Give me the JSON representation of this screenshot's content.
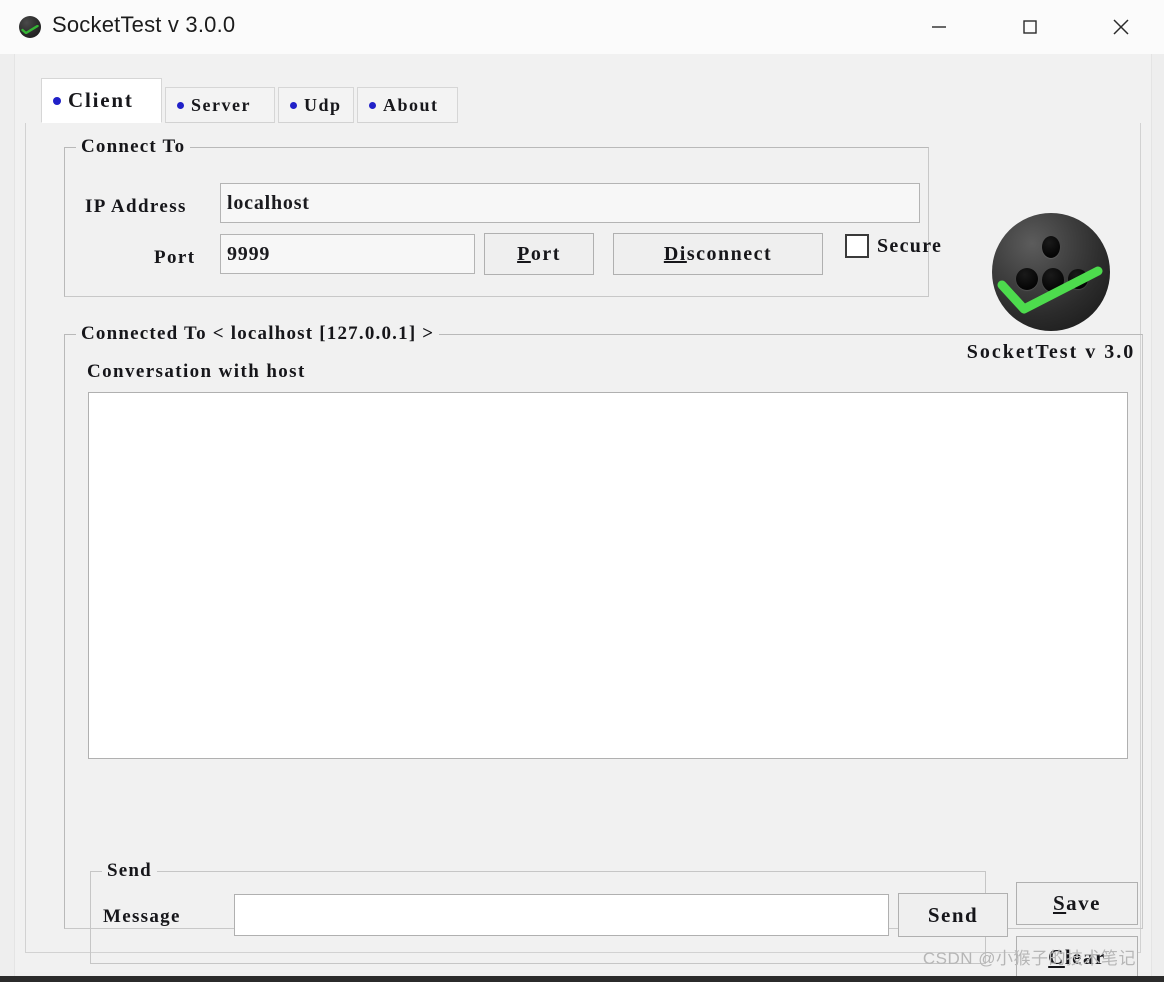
{
  "window": {
    "title": "SocketTest v 3.0.0",
    "icon": "socket-app-icon",
    "controls": {
      "minimize": "minimize-icon",
      "maximize": "maximize-icon",
      "close": "close-icon"
    }
  },
  "tabs": [
    {
      "label": "Client",
      "active": true
    },
    {
      "label": "Server",
      "active": false
    },
    {
      "label": "Udp",
      "active": false
    },
    {
      "label": "About",
      "active": false
    }
  ],
  "connect_to": {
    "group_title": "Connect To",
    "ip_label": "IP Address",
    "ip_value": "localhost",
    "ip_placeholder": "",
    "port_label": "Port",
    "port_value": "9999",
    "port_placeholder": "",
    "port_button": "Port",
    "port_button_accel": "P",
    "port_button_rest": "ort",
    "disconnect_button": "Disconnect",
    "disconnect_accel": "Di",
    "disconnect_rest": "sconnect",
    "secure_label": "Secure",
    "secure_checked": false
  },
  "logo": {
    "caption": "SocketTest v 3.0",
    "sphere": "socket-sphere-icon",
    "check": "green-check-icon",
    "check_color": "#4ddb4d"
  },
  "connected_to": {
    "group_title": "Connected To <  localhost [127.0.0.1]  >",
    "conversation_label": "Conversation with host",
    "conversation_text": ""
  },
  "send": {
    "group_title": "Send",
    "message_label": "Message",
    "message_value": "",
    "message_placeholder": "",
    "send_button": "Send"
  },
  "side_actions": {
    "save_accel": "S",
    "save_rest": "ave",
    "clear_accel": "C",
    "clear_rest": "lear"
  },
  "watermark": "CSDN @小猴子的技术笔记",
  "colors": {
    "tab_dot": "#2020c8",
    "window_bg": "#f0f0f0",
    "field_bg": "#ffffff",
    "accent_green": "#4ddb4d"
  }
}
